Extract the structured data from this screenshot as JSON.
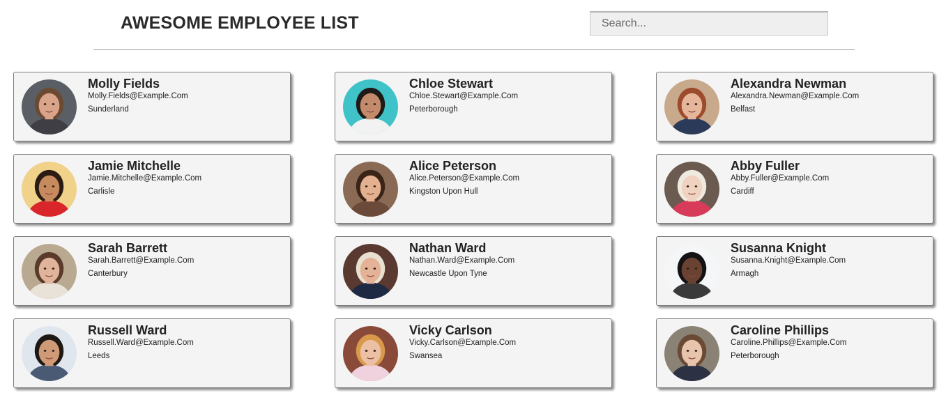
{
  "header": {
    "title": "AWESOME EMPLOYEE LIST",
    "search_placeholder": "Search...",
    "search_value": ""
  },
  "employees": [
    {
      "name": "Molly Fields",
      "email": "Molly.Fields@Example.Com",
      "city": "Sunderland",
      "palette": {
        "bg": "#5a5f66",
        "skin": "#d9a489",
        "hair": "#6b4a33",
        "shirt": "#3e3e44"
      }
    },
    {
      "name": "Chloe Stewart",
      "email": "Chloe.Stewart@Example.Com",
      "city": "Peterborough",
      "palette": {
        "bg": "#3fc3c9",
        "skin": "#c48a6c",
        "hair": "#1e1a18",
        "shirt": "#f2f2f2"
      }
    },
    {
      "name": "Alexandra Newman",
      "email": "Alexandra.Newman@Example.Com",
      "city": "Belfast",
      "palette": {
        "bg": "#c9a98b",
        "skin": "#e6b69a",
        "hair": "#9c4b2c",
        "shirt": "#2c3a5a"
      }
    },
    {
      "name": "Jamie Mitchelle",
      "email": "Jamie.Mitchelle@Example.Com",
      "city": "Carlisle",
      "palette": {
        "bg": "#f0d28a",
        "skin": "#c68a5e",
        "hair": "#2a1c14",
        "shirt": "#d8262b"
      }
    },
    {
      "name": "Alice Peterson",
      "email": "Alice.Peterson@Example.Com",
      "city": "Kingston Upon Hull",
      "palette": {
        "bg": "#8a6a54",
        "skin": "#e3b190",
        "hair": "#3a2418",
        "shirt": "#6b4a3a"
      }
    },
    {
      "name": "Abby Fuller",
      "email": "Abby.Fuller@Example.Com",
      "city": "Cardiff",
      "palette": {
        "bg": "#6a5a50",
        "skin": "#f0d2c0",
        "hair": "#efeae0",
        "shirt": "#d83a5a"
      }
    },
    {
      "name": "Sarah Barrett",
      "email": "Sarah.Barrett@Example.Com",
      "city": "Canterbury",
      "palette": {
        "bg": "#b8a990",
        "skin": "#e0b49a",
        "hair": "#5a3a2a",
        "shirt": "#e8e2d8"
      }
    },
    {
      "name": "Nathan Ward",
      "email": "Nathan.Ward@Example.Com",
      "city": "Newcastle Upon Tyne",
      "palette": {
        "bg": "#5a3a30",
        "skin": "#e4b296",
        "hair": "#e8e0d0",
        "shirt": "#1e2a44"
      }
    },
    {
      "name": "Susanna Knight",
      "email": "Susanna.Knight@Example.Com",
      "city": "Armagh",
      "palette": {
        "bg": "#f4f6f8",
        "skin": "#6a4232",
        "hair": "#141214",
        "shirt": "#3a3a3a"
      }
    },
    {
      "name": "Russell Ward",
      "email": "Russell.Ward@Example.Com",
      "city": "Leeds",
      "palette": {
        "bg": "#dfe6ee",
        "skin": "#d09a76",
        "hair": "#1e1814",
        "shirt": "#4a5a74"
      }
    },
    {
      "name": "Vicky Carlson",
      "email": "Vicky.Carlson@Example.Com",
      "city": "Swansea",
      "palette": {
        "bg": "#8a4a3a",
        "skin": "#ecc0a4",
        "hair": "#d89a4a",
        "shirt": "#f0d2de"
      }
    },
    {
      "name": "Caroline Phillips",
      "email": "Caroline.Phillips@Example.Com",
      "city": "Peterborough",
      "palette": {
        "bg": "#8a8274",
        "skin": "#e8c4ac",
        "hair": "#6a4a34",
        "shirt": "#2c3244"
      }
    }
  ]
}
